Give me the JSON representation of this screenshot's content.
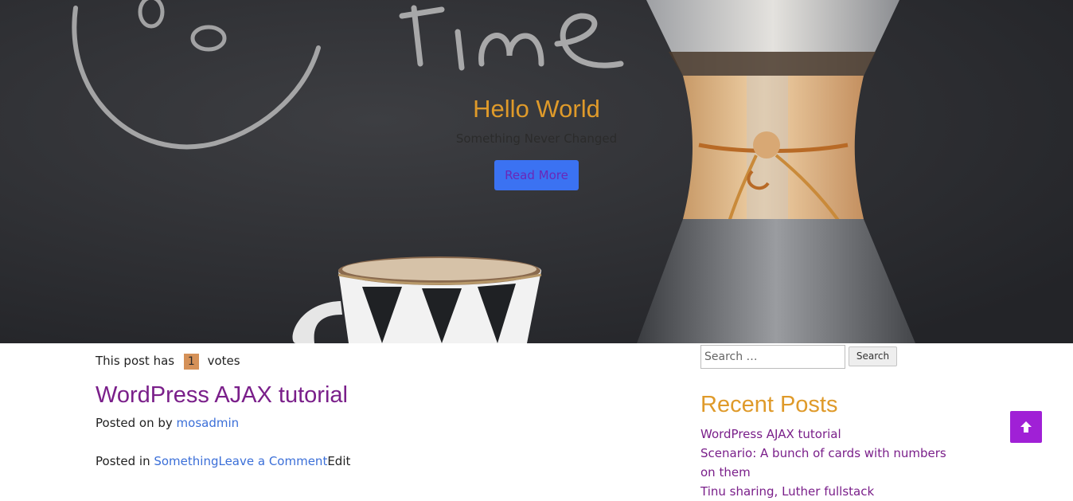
{
  "hero": {
    "title": "Hello World",
    "subtitle": "Something Never Changed",
    "button_label": "Read More"
  },
  "post": {
    "votes_prefix": "This post has",
    "votes_count": "1",
    "votes_suffix": "votes",
    "title": "WordPress AJAX tutorial",
    "posted_on_prefix": "Posted on by",
    "author": "mosadmin",
    "posted_in_prefix": "Posted in",
    "category": "Something",
    "comment_link": "Leave a Comment",
    "edit_link": "Edit"
  },
  "sidebar": {
    "search_placeholder": "Search …",
    "search_button": "Search",
    "recent_title": "Recent Posts",
    "recent_posts": [
      "WordPress AJAX tutorial",
      "Scenario: A bunch of cards with numbers on them",
      "Tinu sharing, Luther fullstack"
    ]
  },
  "scroll_top": {
    "icon": "arrow-up-icon"
  },
  "colors": {
    "accent_orange": "#df9a2a",
    "link_purple": "#7a1f8a",
    "link_blue": "#3b6fd8",
    "button_blue": "#3b72f2",
    "scroll_top_purple": "#a020d6",
    "vote_badge": "#d59158"
  }
}
